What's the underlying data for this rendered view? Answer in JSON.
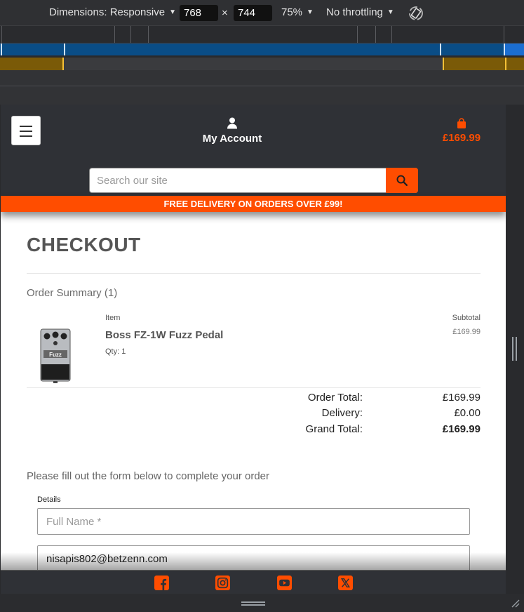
{
  "devtools": {
    "dimensions_label": "Dimensions: Responsive",
    "width_value": "768",
    "times": "×",
    "height_value": "744",
    "zoom": "75%",
    "throttling": "No throttling"
  },
  "header": {
    "account_label": "My Account",
    "cart_total": "£169.99",
    "search_placeholder": "Search our site"
  },
  "banner": {
    "text": "FREE DELIVERY ON ORDERS OVER £99!"
  },
  "checkout": {
    "title": "CHECKOUT",
    "order_summary": "Order Summary (1)",
    "col_item": "Item",
    "col_subtotal": "Subtotal",
    "item": {
      "name": "Boss FZ-1W Fuzz Pedal",
      "qty": "Qty: 1",
      "price": "£169.99"
    },
    "totals": {
      "order_total_label": "Order Total:",
      "order_total": "£169.99",
      "delivery_label": "Delivery:",
      "delivery": "£0.00",
      "grand_total_label": "Grand Total:",
      "grand_total": "£169.99"
    },
    "form_intro": "Please fill out the form below to complete your order",
    "details_label": "Details",
    "full_name_placeholder": "Full Name *",
    "email_value": "nisapis802@betzenn.com"
  },
  "colors": {
    "accent": "#ff4d00",
    "header_bg": "#2f3136"
  },
  "footer": {
    "icons": [
      "facebook-icon",
      "instagram-icon",
      "youtube-icon",
      "x-icon"
    ]
  }
}
